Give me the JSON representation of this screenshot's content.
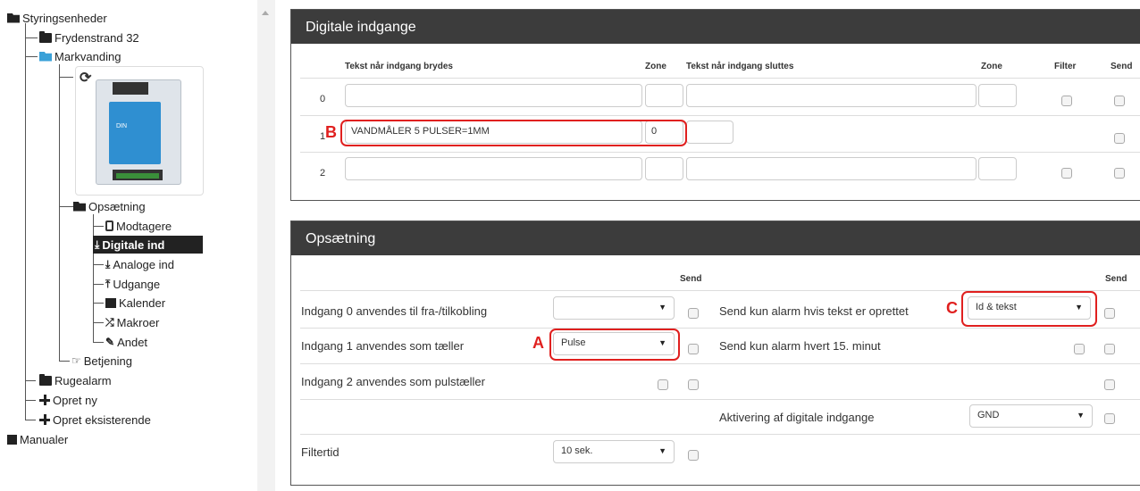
{
  "tree": {
    "root": "Styringsenheder",
    "frydenstrand": "Frydenstrand 32",
    "markvanding": "Markvanding",
    "opsaetning": "Opsætning",
    "modtagere": "Modtagere",
    "digitale": "Digitale ind",
    "analoge": "Analoge ind",
    "udgange": "Udgange",
    "kalender": "Kalender",
    "makroer": "Makroer",
    "andet": "Andet",
    "betjening": "Betjening",
    "rugealarm": "Rugealarm",
    "opret_ny": "Opret ny",
    "opret_eks": "Opret eksisterende",
    "manualer": "Manualer"
  },
  "device_image": {
    "face_text": "DIN"
  },
  "digital": {
    "title": "Digitale indgange",
    "col_break": "Tekst når indgang brydes",
    "col_zone1": "Zone",
    "col_close": "Tekst når indgang sluttes",
    "col_zone2": "Zone",
    "col_filter": "Filter",
    "col_send": "Send",
    "rows": [
      {
        "num": "0",
        "break_text": "",
        "zone": ""
      },
      {
        "num": "1",
        "break_text": "VANDMÅLER 5 PULSER=1MM",
        "zone": "0"
      },
      {
        "num": "2",
        "break_text": "",
        "zone": ""
      }
    ]
  },
  "setup": {
    "title": "Opsætning",
    "send_label": "Send",
    "send_label2": "Send",
    "left": [
      {
        "label": "Indgang 0 anvendes til fra-/tilkobling",
        "value": ""
      },
      {
        "label": "Indgang 1 anvendes som tæller",
        "value": "Pulse"
      },
      {
        "label": "Indgang 2 anvendes som pulstæller",
        "value": ""
      },
      {
        "label": "Filtertid",
        "value": "10 sek."
      }
    ],
    "right": [
      {
        "label": "Send kun alarm hvis tekst er oprettet",
        "value": "Id & tekst"
      },
      {
        "label": "Send kun alarm hvert 15. minut",
        "value": ""
      },
      {
        "label": "Aktivering af digitale indgange",
        "value": "GND"
      }
    ]
  },
  "annotations": {
    "a": "A",
    "b": "B",
    "c": "C"
  },
  "colors": {
    "annotation": "#e0201f",
    "panel_header": "#3c3c3c",
    "active_node": "#222222",
    "folder_blue": "#3aa1d8"
  }
}
